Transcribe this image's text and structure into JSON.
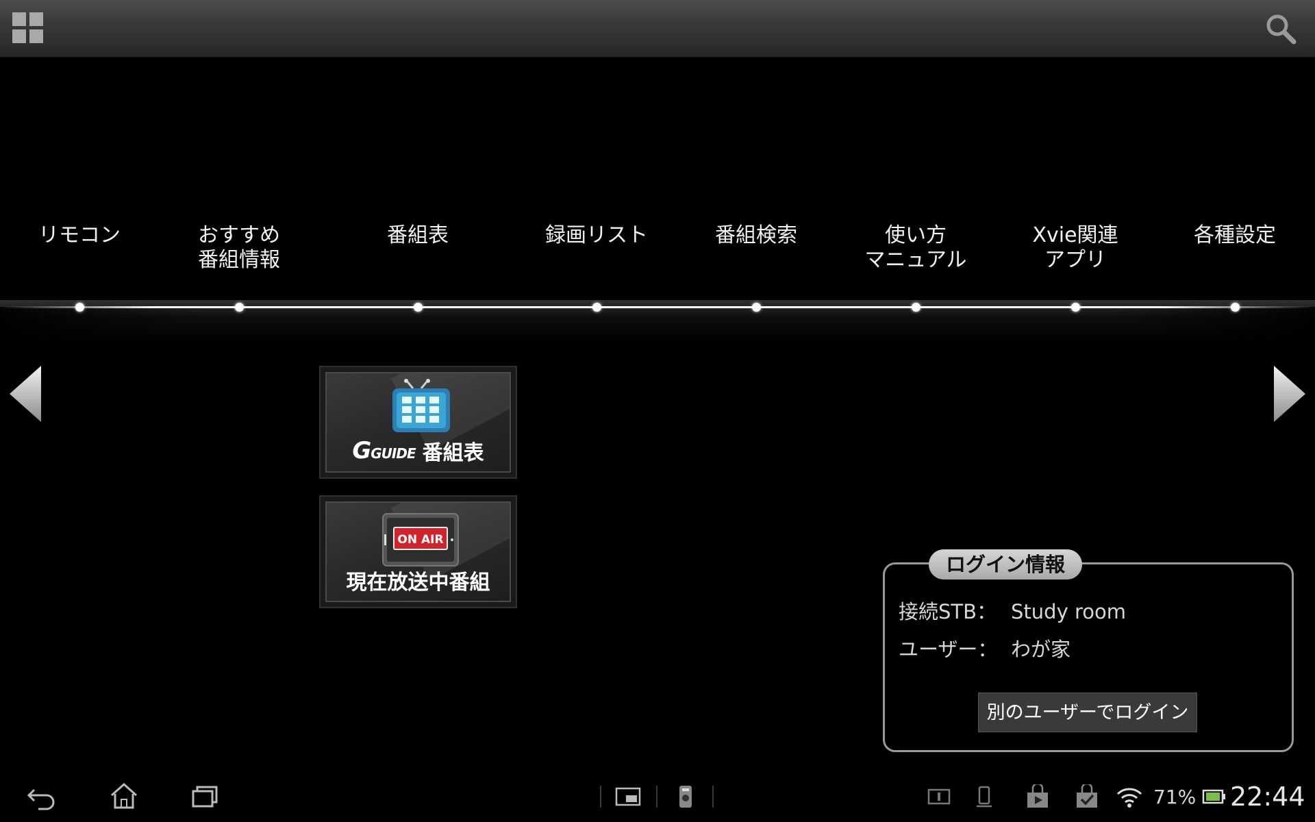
{
  "colors": {
    "background": "#000000",
    "topbar": "#3a3a3a",
    "track": "#ffffff",
    "panel_border": "#9a9a9a",
    "onair_red": "#d2232a",
    "tv_blue": "#3aa6d8",
    "battery_green": "#7bc043"
  },
  "topbar": {
    "apps_icon": "grid-icon",
    "search_icon": "search-icon"
  },
  "menu": [
    {
      "label": "リモコン"
    },
    {
      "label": "おすすめ\n番組情報"
    },
    {
      "label": "番組表"
    },
    {
      "label": "録画リスト"
    },
    {
      "label": "番組検索"
    },
    {
      "label": "使い方\nマニュアル"
    },
    {
      "label": "Xvie関連\nアプリ"
    },
    {
      "label": "各種設定"
    }
  ],
  "tiles": {
    "guide": {
      "brand": "GUIDE",
      "label": "番組表"
    },
    "onair": {
      "badge": "ON AIR",
      "label": "現在放送中番組"
    }
  },
  "login": {
    "title": "ログイン情報",
    "stb_label": "接続STB：",
    "stb_value": "Study room",
    "user_label": "ユーザー：",
    "user_value": "わが家",
    "switch_button": "別のユーザーでログイン"
  },
  "statusbar": {
    "battery_percent": "71%",
    "time": "22:44"
  }
}
